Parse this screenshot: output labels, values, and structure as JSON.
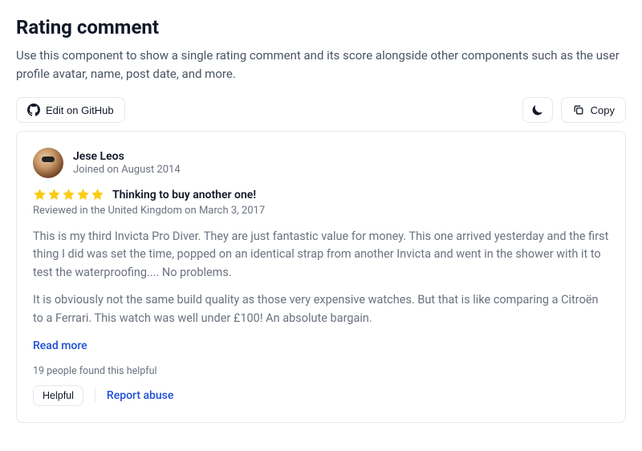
{
  "page": {
    "title": "Rating comment",
    "description": "Use this component to show a single rating comment and its score alongside other components such as the user profile avatar, name, post date, and more."
  },
  "toolbar": {
    "edit_label": "Edit on GitHub",
    "copy_label": "Copy"
  },
  "review": {
    "user_name": "Jese Leos",
    "joined": "Joined on August 2014",
    "stars": 5,
    "title": "Thinking to buy another one!",
    "meta": "Reviewed in the United Kingdom on March 3, 2017",
    "para1": "This is my third Invicta Pro Diver. They are just fantastic value for money. This one arrived yesterday and the first thing I did was set the time, popped on an identical strap from another Invicta and went in the shower with it to test the waterproofing.... No problems.",
    "para2": "It is obviously not the same build quality as those very expensive watches. But that is like comparing a Citroën to a Ferrari. This watch was well under £100! An absolute bargain.",
    "read_more": "Read more",
    "helpful_count": "19 people found this helpful",
    "helpful_btn": "Helpful",
    "report": "Report abuse"
  }
}
